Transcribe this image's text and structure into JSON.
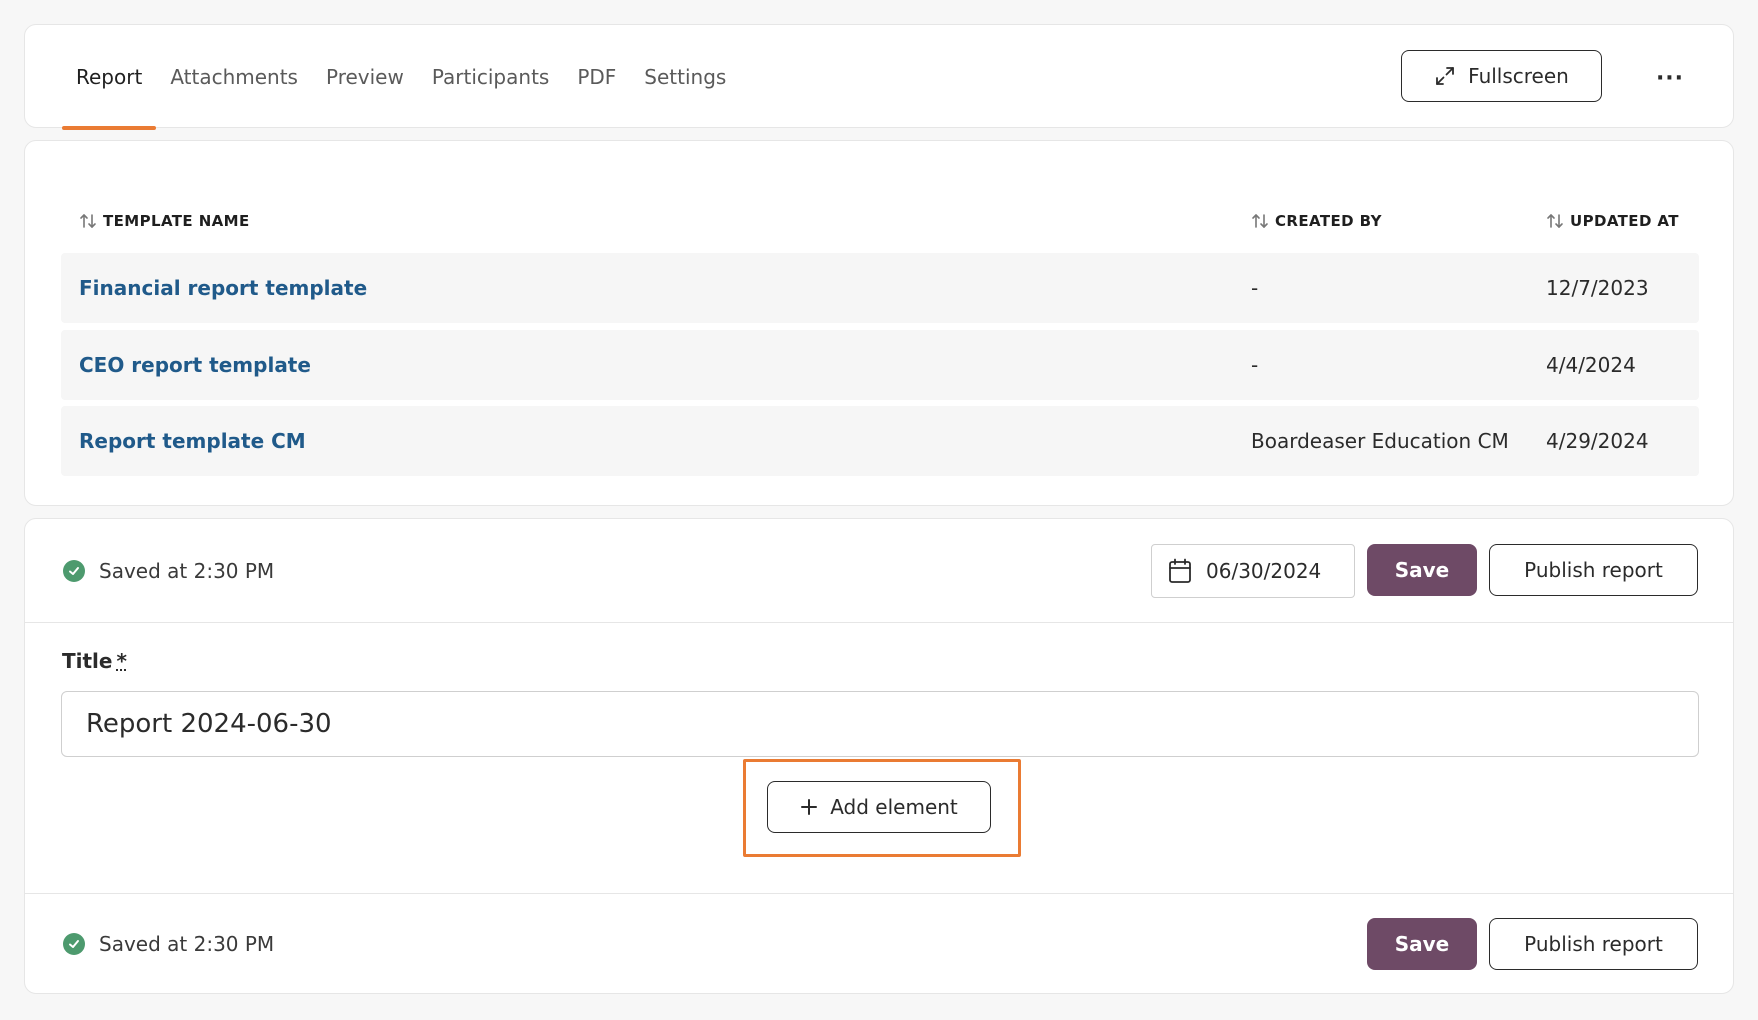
{
  "tabs": [
    {
      "label": "Report",
      "active": true
    },
    {
      "label": "Attachments",
      "active": false
    },
    {
      "label": "Preview",
      "active": false
    },
    {
      "label": "Participants",
      "active": false
    },
    {
      "label": "PDF",
      "active": false
    },
    {
      "label": "Settings",
      "active": false
    }
  ],
  "header": {
    "fullscreen_label": "Fullscreen",
    "fullscreen_icon": "expand-icon",
    "more_icon": "more-horizontal-icon",
    "more_label": "···"
  },
  "templates_table": {
    "columns": [
      {
        "label": "TEMPLATE NAME",
        "icon": "sort-icon"
      },
      {
        "label": "CREATED BY",
        "icon": "sort-icon"
      },
      {
        "label": "UPDATED AT",
        "icon": "sort-icon"
      }
    ],
    "rows": [
      {
        "name": "Financial report template",
        "created_by": "-",
        "updated_at": "12/7/2023"
      },
      {
        "name": "CEO report template",
        "created_by": "-",
        "updated_at": "4/4/2024"
      },
      {
        "name": "Report template CM",
        "created_by": "Boardeaser Education CM",
        "updated_at": "4/29/2024"
      }
    ]
  },
  "editor": {
    "saved_status": "Saved at 2:30 PM",
    "date_value": "06/30/2024",
    "save_label": "Save",
    "publish_label": "Publish report",
    "title_label": "Title",
    "required_marker": "*",
    "title_value": "Report 2024-06-30",
    "add_element_label": "Add element"
  },
  "footer": {
    "saved_status": "Saved at 2:30 PM",
    "save_label": "Save",
    "publish_label": "Publish report"
  },
  "colors": {
    "accent": "#ea7b33",
    "primary_button": "#6e4a66",
    "link": "#205a8a",
    "success": "#4d9a6e"
  }
}
